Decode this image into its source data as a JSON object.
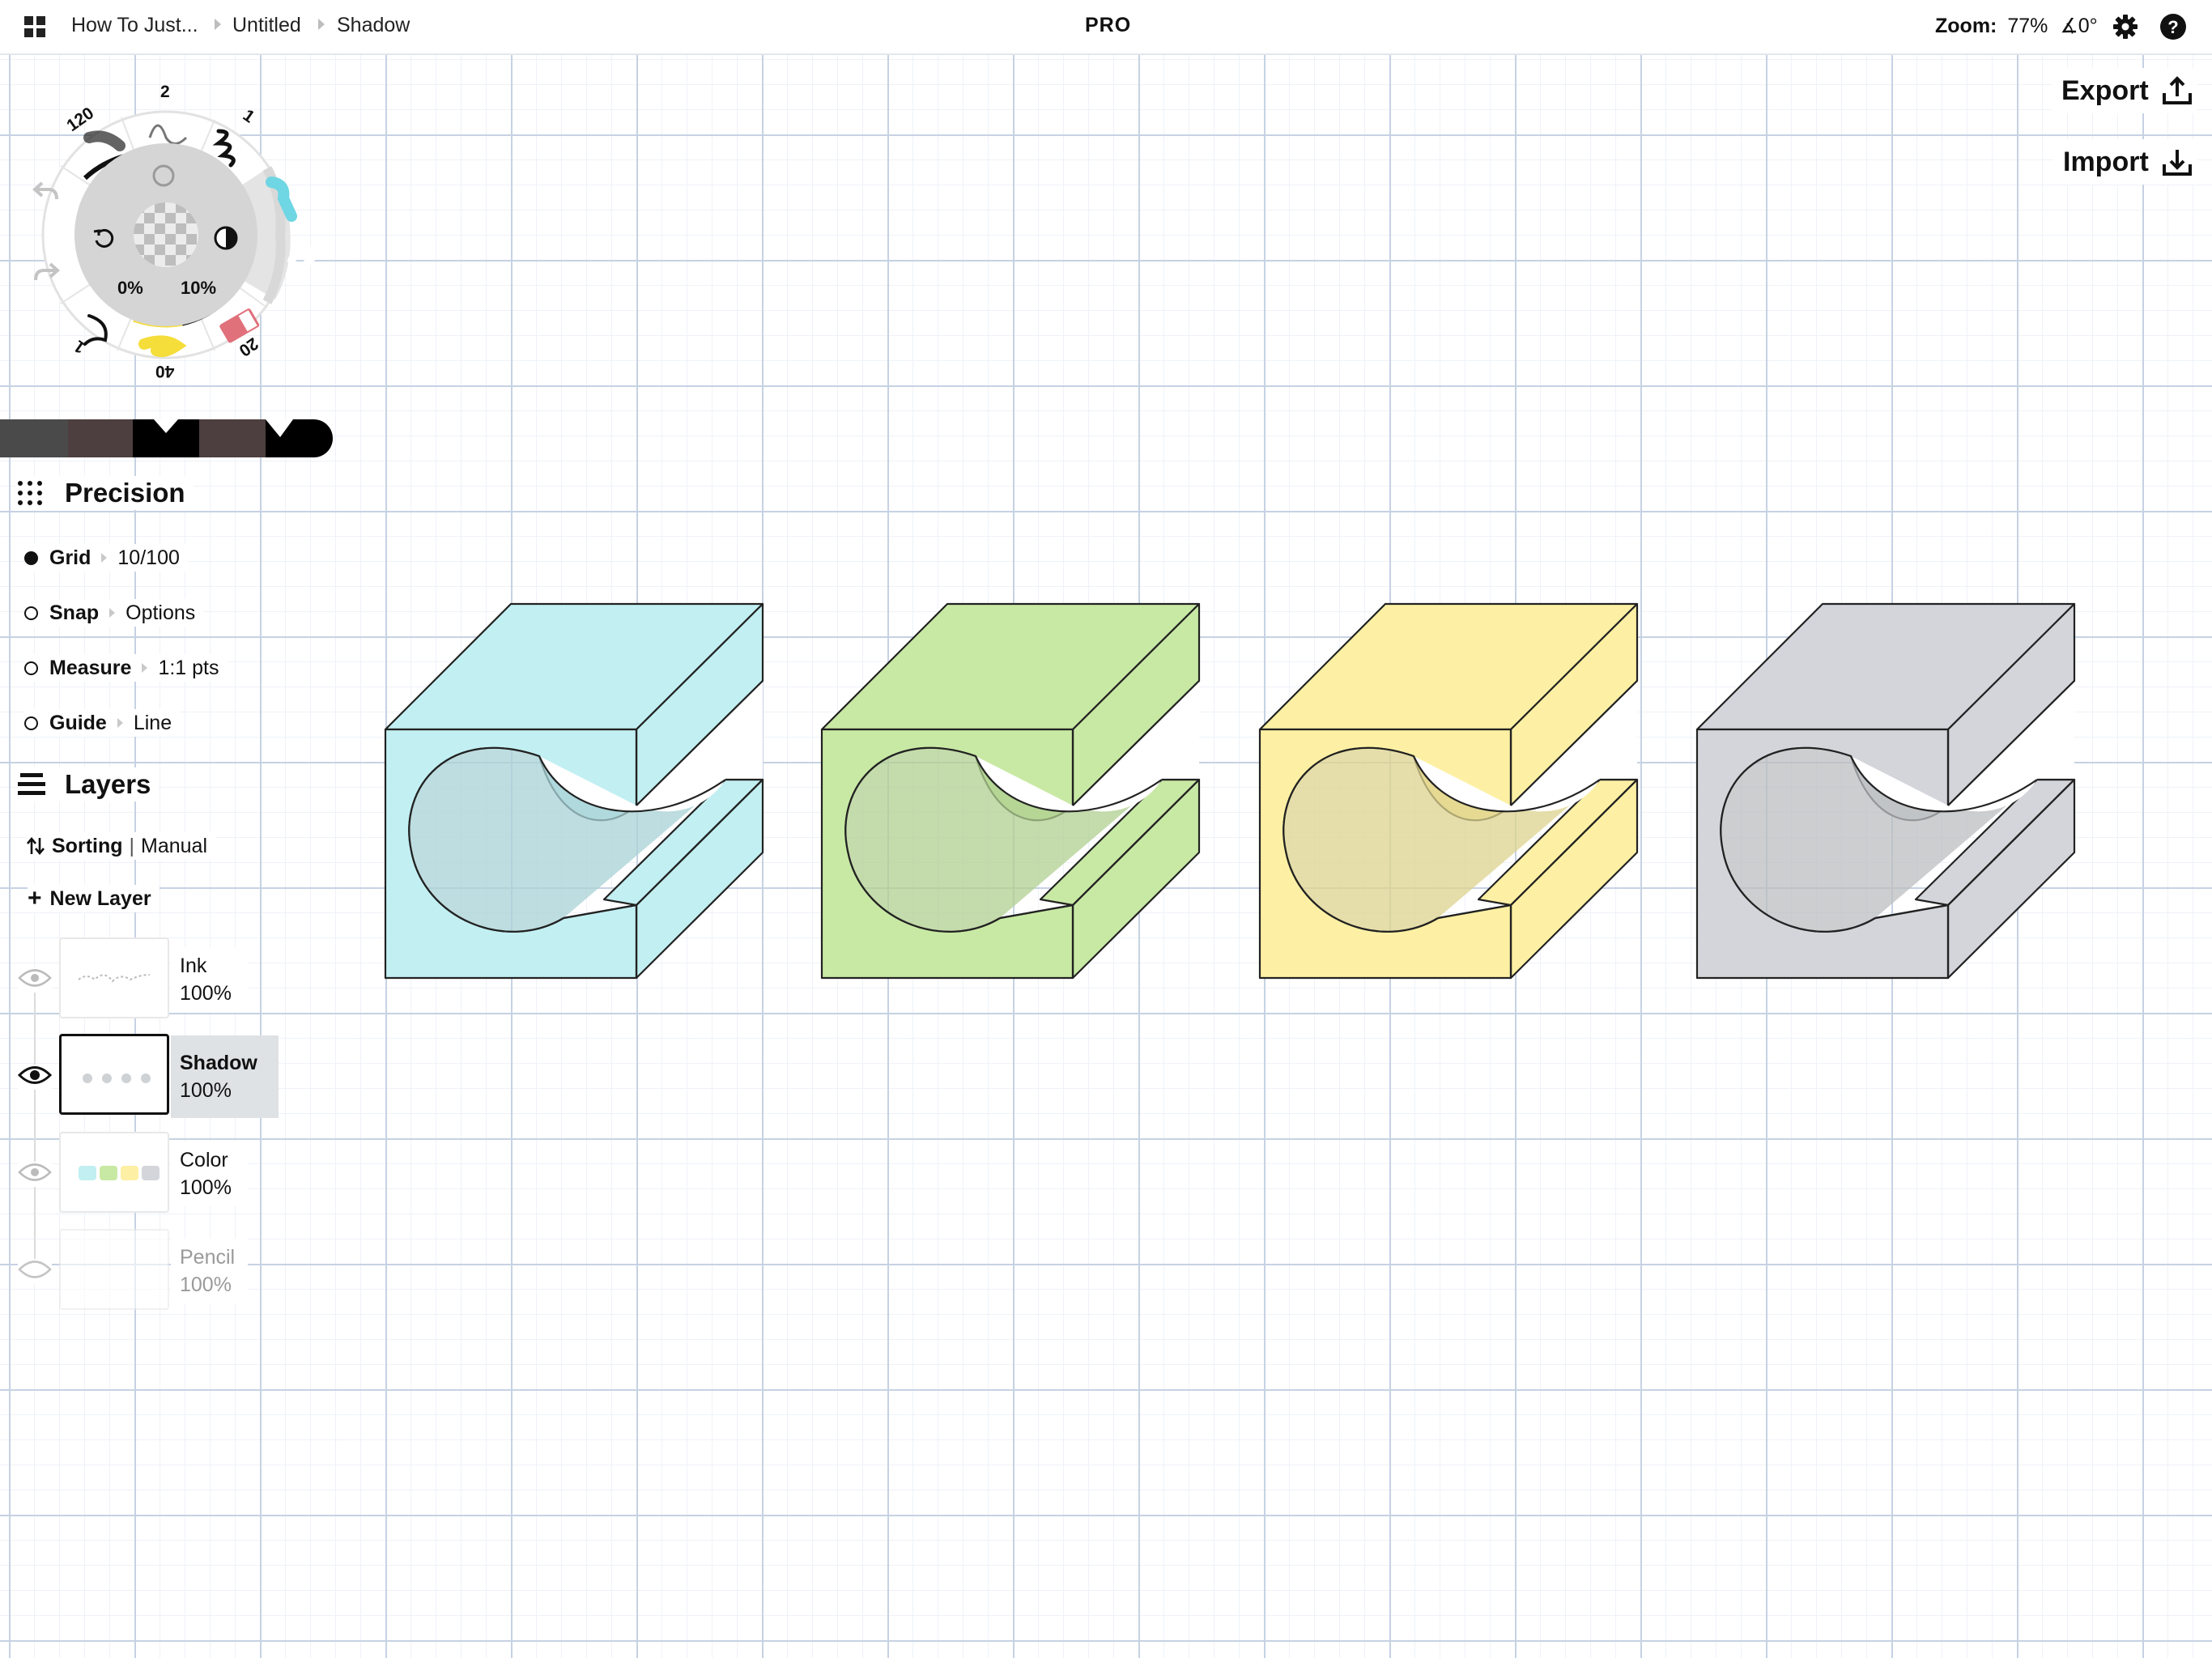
{
  "topbar": {
    "breadcrumbs": [
      "How To Just...",
      "Untitled",
      "Shadow"
    ],
    "badge": "PRO",
    "zoom_label": "Zoom:",
    "zoom_value": "77%",
    "rotation": "∡0°",
    "icons": [
      "apps-grid-icon",
      "settings-gear-icon",
      "help-icon"
    ]
  },
  "actions": {
    "export_label": "Export",
    "import_label": "Import"
  },
  "tool_wheel": {
    "sizes": [
      "120",
      "2",
      "1",
      "20",
      "40",
      "1"
    ],
    "opacity": "0%",
    "smoothing": "10%",
    "tools": [
      "airbrush",
      "pencil",
      "pen",
      "marker",
      "eraser",
      "highlighter",
      "fine-pen",
      "watercolor"
    ],
    "tool_colors": {
      "marker": "#6fd6e3",
      "eraser": "#e0707a",
      "highlighter": "#f5dd3a"
    },
    "icons": [
      "undo-icon",
      "redo-icon",
      "reset-icon",
      "contrast-icon",
      "brush-shape-icon"
    ]
  },
  "palette": {
    "swatches": [
      "#4a4a4a",
      "#4d3f3f",
      "#000000",
      "#4d3f3f",
      "#000000"
    ]
  },
  "precision": {
    "title": "Precision",
    "rows": [
      {
        "label": "Grid",
        "value": "10/100",
        "on": true
      },
      {
        "label": "Snap",
        "value": "Options",
        "on": false
      },
      {
        "label": "Measure",
        "value": "1:1 pts",
        "on": false
      },
      {
        "label": "Guide",
        "value": "Line",
        "on": false
      }
    ]
  },
  "layers": {
    "title": "Layers",
    "sorting_label": "Sorting",
    "sorting_value": "Manual",
    "new_layer_label": "New Layer",
    "items": [
      {
        "name": "Ink",
        "opacity": "100%",
        "visible": true,
        "selected": false
      },
      {
        "name": "Shadow",
        "opacity": "100%",
        "visible": true,
        "selected": true
      },
      {
        "name": "Color",
        "opacity": "100%",
        "visible": true,
        "selected": false
      },
      {
        "name": "Pencil",
        "opacity": "100%",
        "visible": false,
        "selected": false
      }
    ]
  },
  "canvas": {
    "shapes": [
      {
        "name": "cyan-block",
        "fill": "#c2eff2",
        "shade": "#a8d1d6"
      },
      {
        "name": "green-block",
        "fill": "#c8e9a4",
        "shade": "#b0cf90"
      },
      {
        "name": "yellow-block",
        "fill": "#fdf0a4",
        "shade": "#ddd38e"
      },
      {
        "name": "gray-block",
        "fill": "#d3d5da",
        "shade": "#bbbdc0"
      }
    ]
  }
}
